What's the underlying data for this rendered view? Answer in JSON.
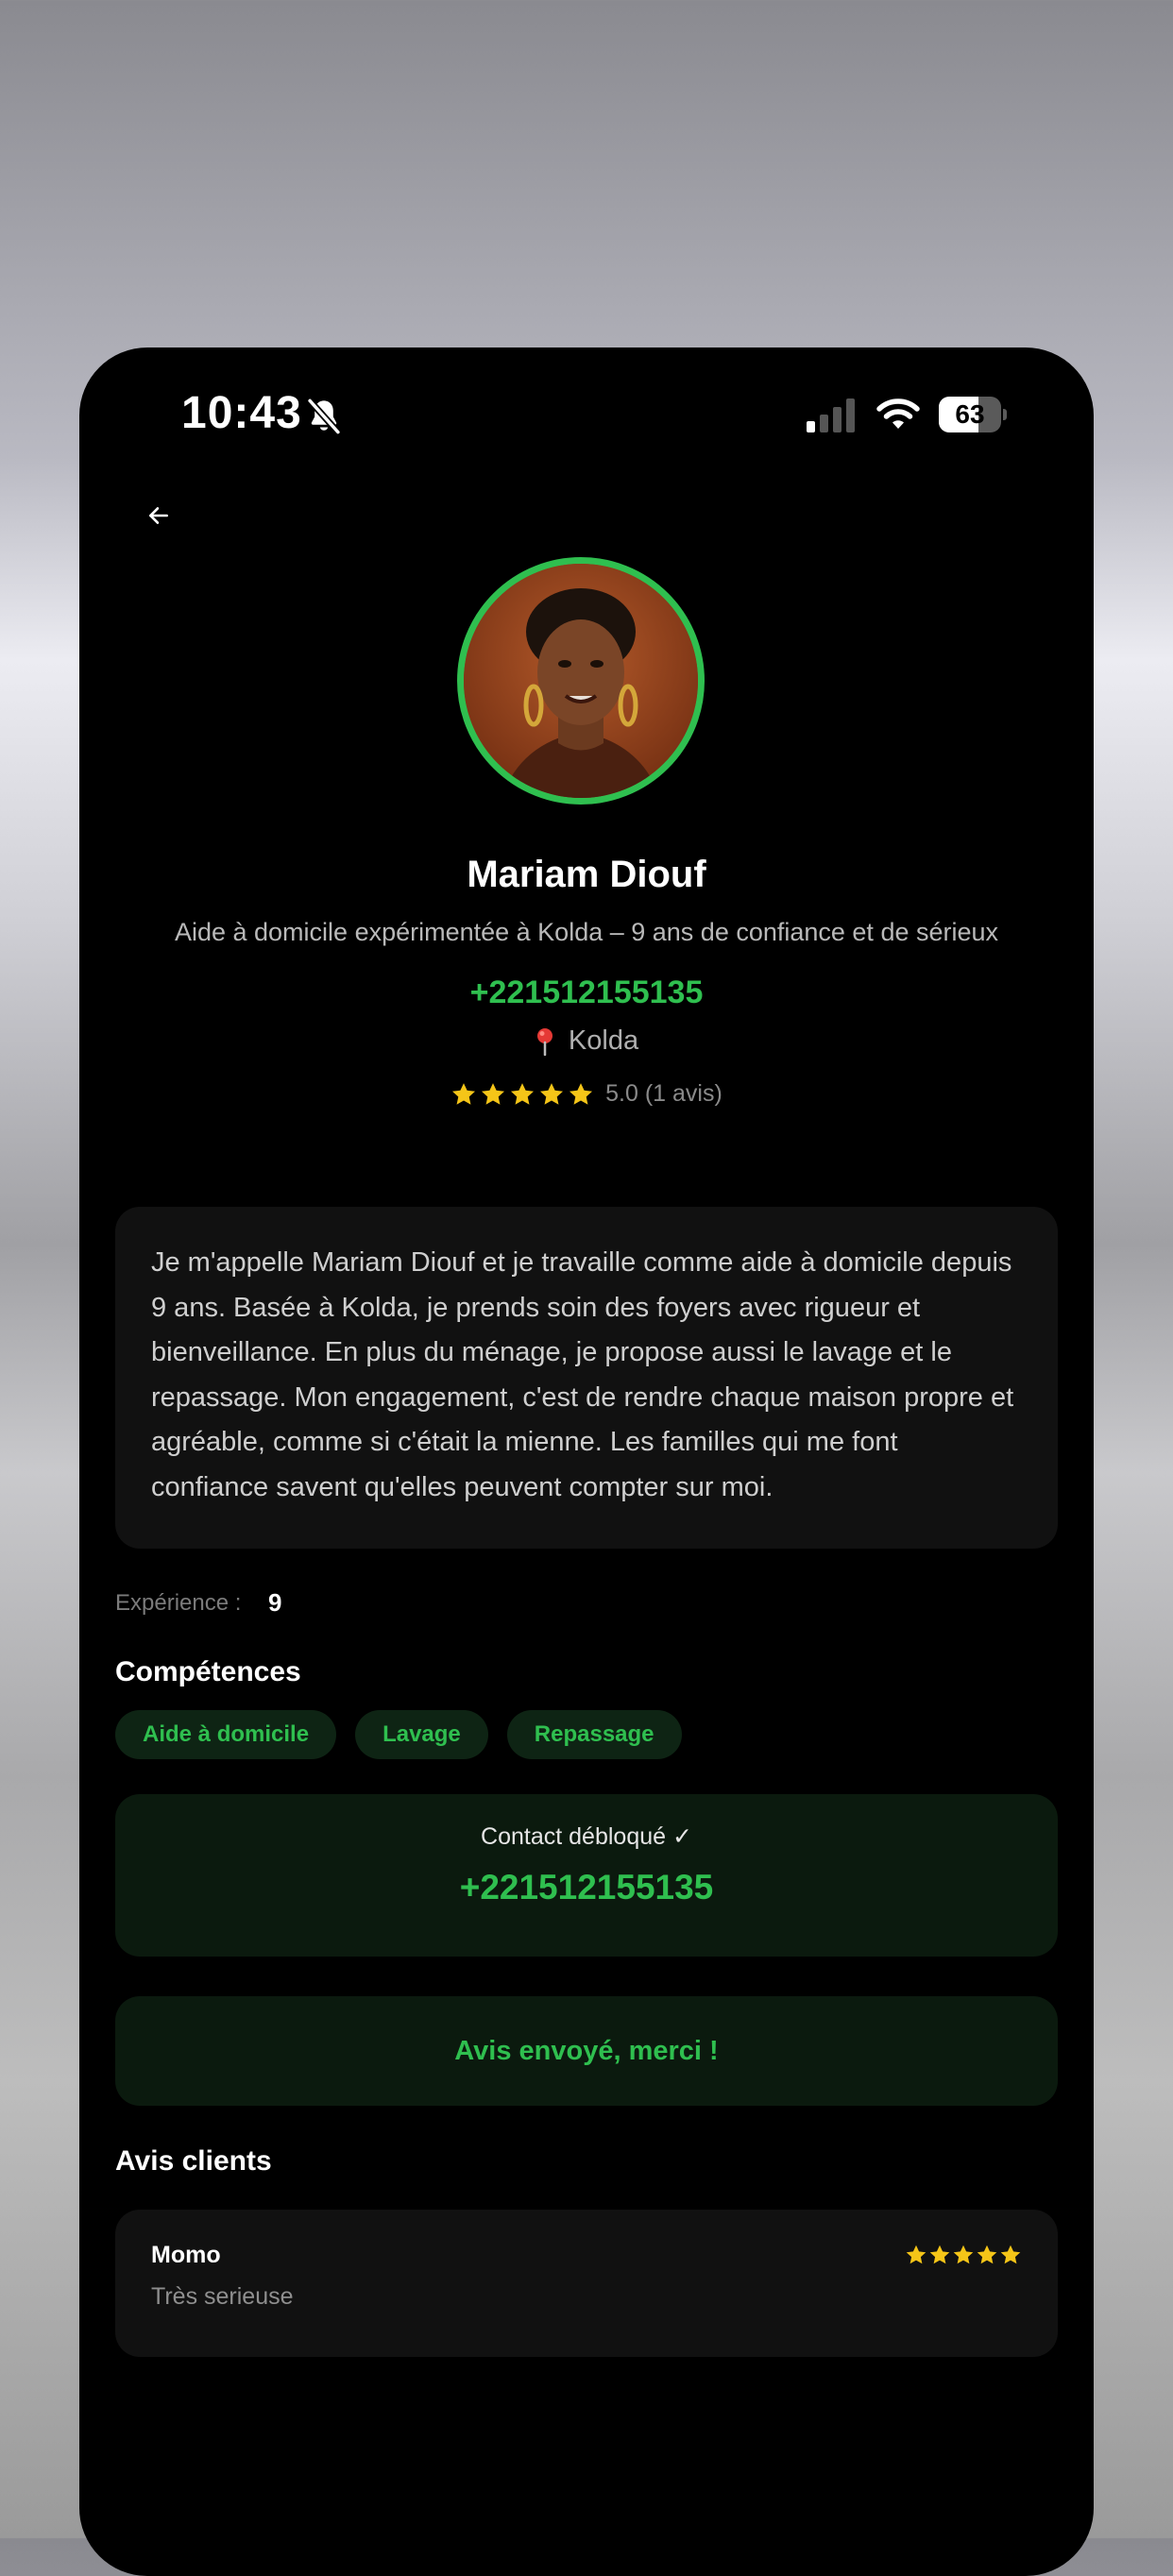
{
  "status_bar": {
    "time": "10:43",
    "battery_percent": "63",
    "battery_level": 0.63
  },
  "profile": {
    "name": "Mariam Diouf",
    "subtitle": "Aide à domicile expérimentée à Kolda – 9 ans de confiance et de sérieux",
    "phone": "+221512155135",
    "location": "Kolda",
    "rating_stars": 5,
    "rating_text": "5.0 (1 avis)"
  },
  "about": "Je m'appelle Mariam Diouf et je travaille comme aide à domicile depuis 9 ans. Basée à Kolda, je prends soin des foyers avec rigueur et bienveillance. En plus du ménage, je propose aussi le lavage et le repassage. Mon engagement, c'est de rendre chaque maison propre et agréable, comme si c'était la mienne. Les familles qui me font confiance savent qu'elles peuvent compter sur moi.",
  "experience": {
    "label": "Expérience :",
    "value": "9"
  },
  "skills": {
    "title": "Compétences",
    "items": [
      "Aide à domicile",
      "Lavage",
      "Repassage"
    ]
  },
  "contact": {
    "label": "Contact débloqué ✓",
    "phone": "+221512155135"
  },
  "review_sent": "Avis envoyé, merci !",
  "reviews": {
    "title": "Avis clients",
    "items": [
      {
        "author": "Momo",
        "text": "Très serieuse",
        "stars": 5
      }
    ]
  },
  "colors": {
    "accent": "#2fbf4f",
    "star": "#f5c518",
    "card": "#111111",
    "card_green": "#0b1a0e"
  }
}
